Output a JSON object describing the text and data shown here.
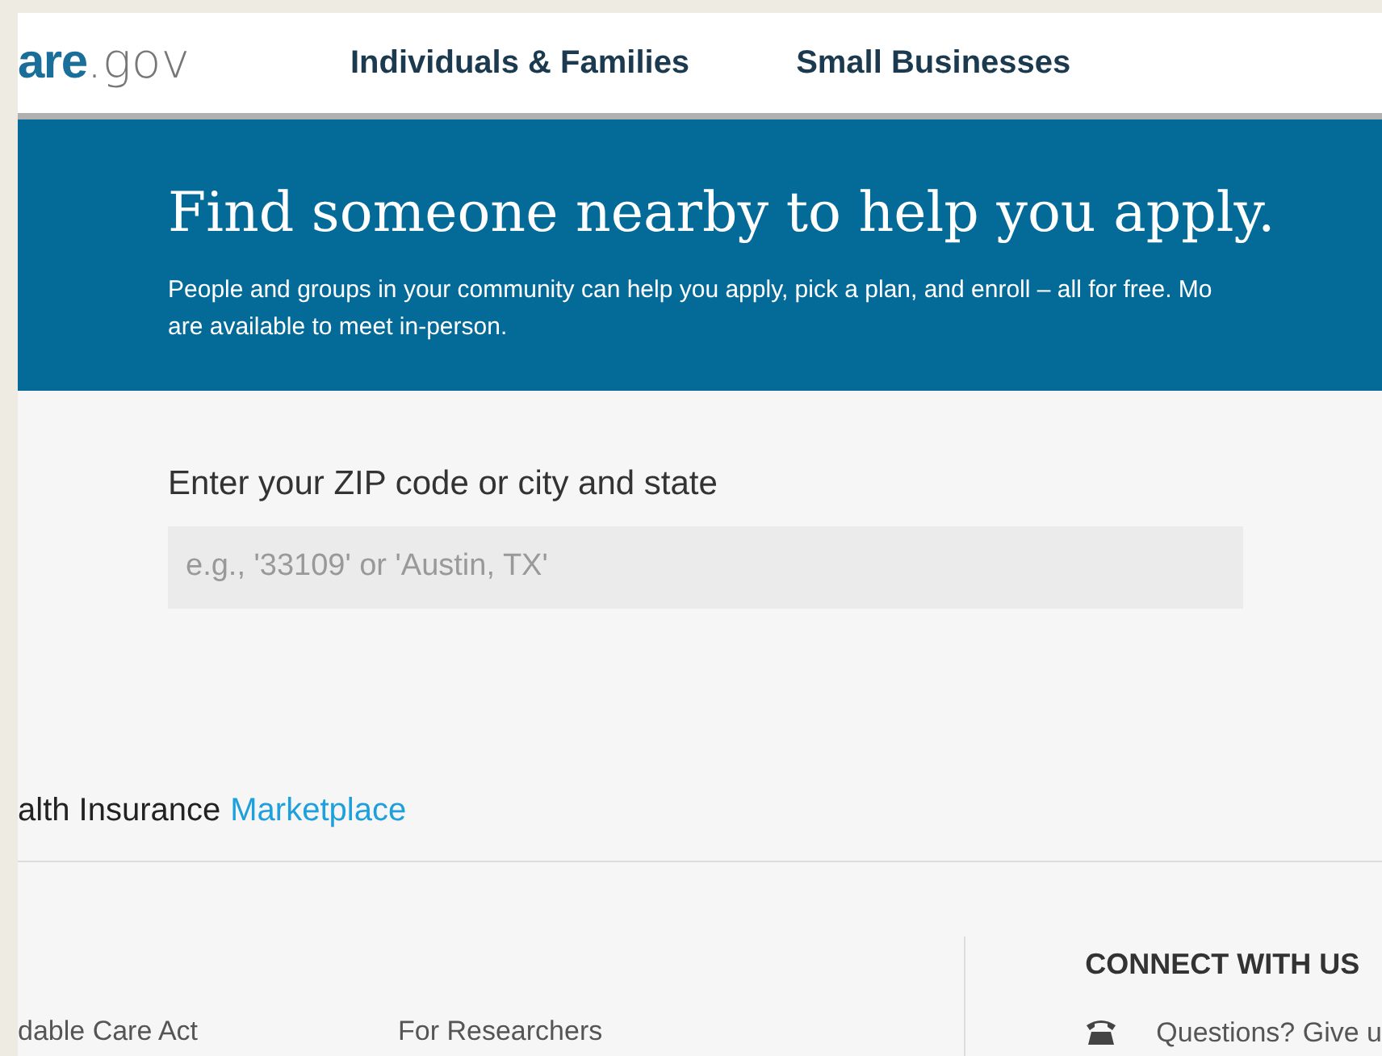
{
  "logo": {
    "brand": "are",
    "suffix": ".gov"
  },
  "nav": [
    {
      "label": "Individuals & Families"
    },
    {
      "label": "Small Businesses"
    }
  ],
  "banner": {
    "title": "Find someone nearby to help you apply.",
    "text": "People and groups in your community can help you apply, pick a plan, and enroll – all for free. Mo",
    "text_line2": "are available to meet in-person."
  },
  "search": {
    "label": "Enter your ZIP code or city and state",
    "placeholder": "e.g., '33109' or 'Austin, TX'"
  },
  "marketplace_logo": {
    "text": "alth Insurance",
    "highlight": "Marketplace"
  },
  "footer": {
    "links": [
      "dable Care Act",
      "For Researchers"
    ],
    "connect": {
      "heading": "CONNECT WITH US",
      "items": [
        "Questions? Give u"
      ]
    }
  }
}
